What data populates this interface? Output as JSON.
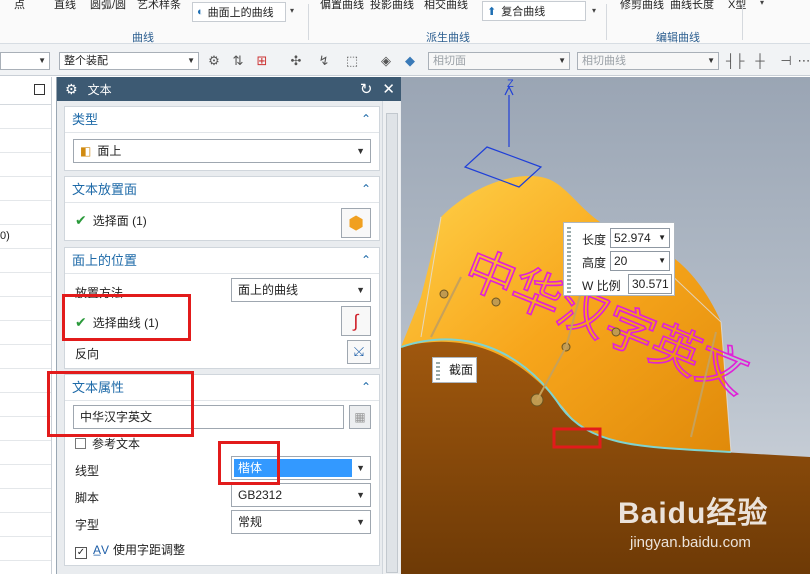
{
  "ribbon": {
    "top_items": [
      "点",
      "直线",
      "圆弧/圆",
      "艺术样条",
      "偏置曲线",
      "投影曲线",
      "相交曲线",
      "修剪曲线",
      "曲线长度",
      "X型"
    ],
    "curve_on_surface_btn": "曲面上的曲线",
    "composite_curve_btn": "复合曲线",
    "groups": [
      "曲线",
      "派生曲线",
      "编辑曲线"
    ]
  },
  "toolbar": {
    "filter_left": "",
    "assembly": "整个装配",
    "phase_face": "相切面",
    "phase_curve": "相切曲线"
  },
  "leftnav": {
    "partial_text": "0)"
  },
  "dialog": {
    "title": "文本",
    "type": {
      "header": "类型",
      "value": "面上"
    },
    "placement_face": {
      "header": "文本放置面",
      "select": "选择面 (1)"
    },
    "position": {
      "header": "面上的位置",
      "method_label": "放置方法",
      "method_value": "面上的曲线",
      "select_curve": "选择曲线 (1)",
      "reverse": "反向"
    },
    "properties": {
      "header": "文本属性",
      "text_value": "中华汉字英文",
      "reference_text": "参考文本",
      "line_type_label": "线型",
      "line_type_value": "楷体",
      "script_label": "脚本",
      "script_value": "GB2312",
      "style_label": "字型",
      "style_value": "常规",
      "kerning": "使用字距调整"
    }
  },
  "viewport": {
    "axis_label": "Z",
    "length_label": "长度",
    "length_value": "52.974",
    "height_label": "高度",
    "height_value": "20",
    "w_ratio_label": "W 比例",
    "w_ratio_value": "30.571",
    "section_label": "截面",
    "text_on_surface": "中华汉字英文"
  },
  "watermark": {
    "brand": "Baidu经验",
    "url": "jingyan.baidu.com"
  },
  "colors": {
    "surface": "#f7a61c",
    "dialog_title": "#3d5a73",
    "section_header": "#1e6aa8",
    "highlight": "#e21b1b",
    "selected": "#3399ff"
  }
}
